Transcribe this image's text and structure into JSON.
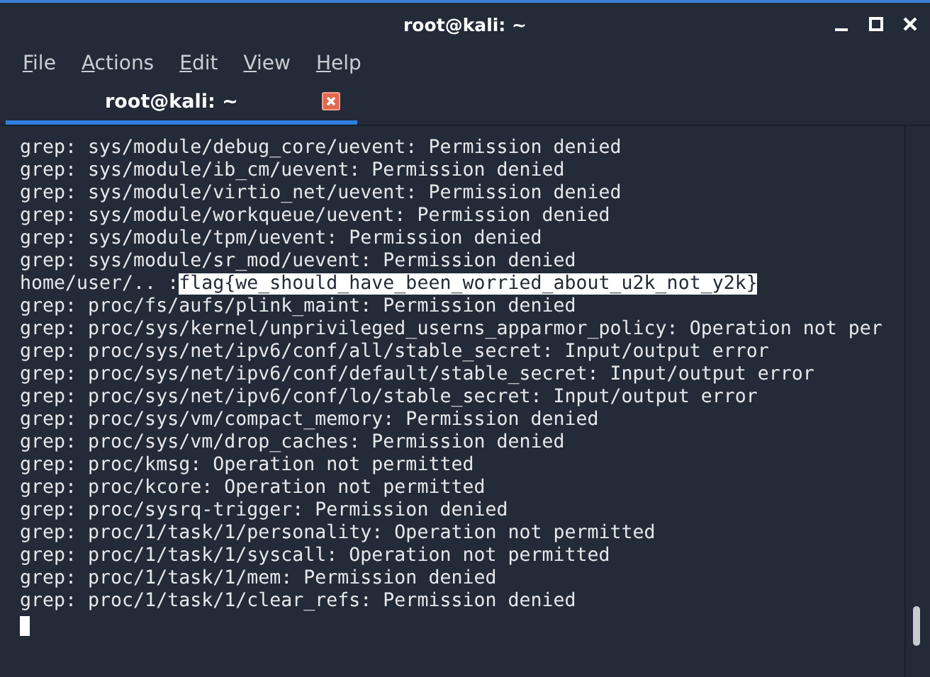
{
  "window": {
    "title": "root@kali: ~"
  },
  "menu": [
    "File",
    "Actions",
    "Edit",
    "View",
    "Help"
  ],
  "tabs": [
    {
      "label": "root@kali: ~",
      "selected": true
    }
  ],
  "terminal": {
    "lines": [
      {
        "text": "grep: sys/module/debug_core/uevent: Permission denied"
      },
      {
        "text": "grep: sys/module/ib_cm/uevent: Permission denied"
      },
      {
        "text": "grep: sys/module/virtio_net/uevent: Permission denied"
      },
      {
        "text": "grep: sys/module/workqueue/uevent: Permission denied"
      },
      {
        "text": "grep: sys/module/tpm/uevent: Permission denied"
      },
      {
        "text": "grep: sys/module/sr_mod/uevent: Permission denied"
      },
      {
        "text": "home/user/.. :",
        "selection": "flag{we_should_have_been_worried_about_u2k_not_y2k}"
      },
      {
        "text": "grep: proc/fs/aufs/plink_maint: Permission denied"
      },
      {
        "text": "grep: proc/sys/kernel/unprivileged_userns_apparmor_policy: Operation not per"
      },
      {
        "text": "grep: proc/sys/net/ipv6/conf/all/stable_secret: Input/output error"
      },
      {
        "text": "grep: proc/sys/net/ipv6/conf/default/stable_secret: Input/output error"
      },
      {
        "text": "grep: proc/sys/net/ipv6/conf/lo/stable_secret: Input/output error"
      },
      {
        "text": "grep: proc/sys/vm/compact_memory: Permission denied"
      },
      {
        "text": "grep: proc/sys/vm/drop_caches: Permission denied"
      },
      {
        "text": "grep: proc/kmsg: Operation not permitted"
      },
      {
        "text": "grep: proc/kcore: Operation not permitted"
      },
      {
        "text": "grep: proc/sysrq-trigger: Permission denied"
      },
      {
        "text": "grep: proc/1/task/1/personality: Operation not permitted"
      },
      {
        "text": "grep: proc/1/task/1/syscall: Operation not permitted"
      },
      {
        "text": "grep: proc/1/task/1/mem: Permission denied"
      },
      {
        "text": "grep: proc/1/task/1/clear_refs: Permission denied"
      }
    ]
  }
}
